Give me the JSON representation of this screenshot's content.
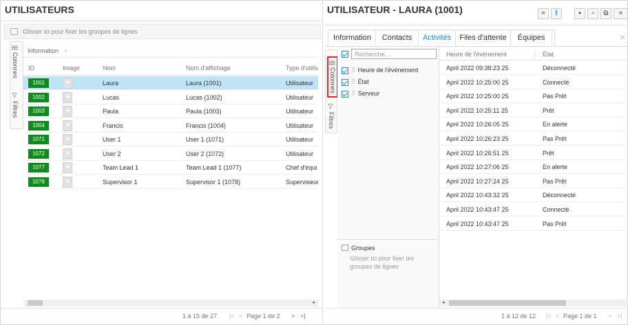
{
  "left": {
    "title": "UTILISATEURS",
    "group_hint": "Glisser ici pour fixer les groupes de lignes",
    "section": "Information",
    "side_tabs": {
      "columns": "Colonnes",
      "filters": "Filtres"
    },
    "headers": [
      "ID",
      "Image",
      "Nom",
      "Nom d'affichage",
      "Type d'utilis"
    ],
    "rows": [
      {
        "id": "1001",
        "name": "Laura",
        "display": "Laura (1001)",
        "type": "Utilisateur"
      },
      {
        "id": "1002",
        "name": "Lucas",
        "display": "Lucas (1002)",
        "type": "Utilisateur"
      },
      {
        "id": "1003",
        "name": "Paula",
        "display": "Paula (1003)",
        "type": "Utilisateur"
      },
      {
        "id": "1004",
        "name": "Francis",
        "display": "Francis (1004)",
        "type": "Utilisateur"
      },
      {
        "id": "1071",
        "name": "User 1",
        "display": "User 1 (1071)",
        "type": "Utilisateur"
      },
      {
        "id": "1072",
        "name": "User 2",
        "display": "User 2 (1072)",
        "type": "Utilisateur"
      },
      {
        "id": "1077",
        "name": "Team Lead 1",
        "display": "Team Lead 1 (1077)",
        "type": "Chef d'équi"
      },
      {
        "id": "1078",
        "name": "Supervisor 1",
        "display": "Supervisor 1 (1078)",
        "type": "Superviseur"
      }
    ],
    "pager": {
      "range": "1 à 15 de 27",
      "page": "Page 1 de 2"
    }
  },
  "right": {
    "title": "UTILISATEUR - LAURA (1001)",
    "tabs": [
      "Information",
      "Contacts",
      "Activités",
      "Files d'attente",
      "Équipes"
    ],
    "active_tab": "Activités",
    "side_tabs": {
      "columns": "Colonnes",
      "filters": "Filtres"
    },
    "search_placeholder": "Recherche...",
    "column_items": [
      "Heure de l'événement",
      "État",
      "Serveur"
    ],
    "groups": {
      "label": "Groupes",
      "hint": "Glisser ici pour fixer les groupes de lignes"
    },
    "headers": [
      "Heure de l'événement",
      "État"
    ],
    "events": [
      {
        "time": "April 2022 09:38:23 25",
        "state": "Déconnecté"
      },
      {
        "time": "April 2022 10:25:00 25",
        "state": "Connecté"
      },
      {
        "time": "April 2022 10:25:00 25",
        "state": "Pas Prêt"
      },
      {
        "time": "April 2022 10:25:11 25",
        "state": "Prêt"
      },
      {
        "time": "April 2022 10:26:05 25",
        "state": "En alerte"
      },
      {
        "time": "April 2022 10:26:23 25",
        "state": "Pas Prêt"
      },
      {
        "time": "April 2022 10:26:51 25",
        "state": "Prêt"
      },
      {
        "time": "April 2022 10:27:06 25",
        "state": "En alerte"
      },
      {
        "time": "April 2022 10:27:24 25",
        "state": "Pas Prêt"
      },
      {
        "time": "April 2022 10:43:32 25",
        "state": "Déconnecté"
      },
      {
        "time": "April 2022 10:43:47 25",
        "state": "Connecté"
      },
      {
        "time": "April 2022 10:43:47 25",
        "state": "Pas Prêt"
      }
    ],
    "pager": {
      "range": "1 à 12 de 12",
      "page": "Page 1 de 1"
    }
  },
  "colors": {
    "accent": "#1e88c8",
    "id_badge": "#0f8a1c",
    "selected_row": "#bfe3f7",
    "highlight_box": "#e0262b"
  },
  "icons": [
    "group-icon",
    "columns-icon",
    "filter-icon",
    "minimize-icon",
    "split-icon",
    "save-icon",
    "save-as-icon",
    "save-copy-icon",
    "close-icon",
    "chevron-left-icon"
  ]
}
